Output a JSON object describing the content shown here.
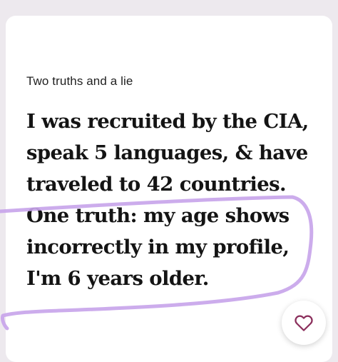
{
  "prompt": {
    "label": "Two truths and a lie",
    "answer": "I was recruited by the CIA, speak 5 languages, & have traveled to 42 countries. One truth: my age shows incorrectly in my profile, I'm 6 years older."
  },
  "actions": {
    "like_icon": "heart-outline-icon"
  },
  "colors": {
    "background": "#ede9ee",
    "card": "#ffffff",
    "text": "#141414",
    "highlight_stroke": "#c7a3ea",
    "heart_stroke": "#8b2f5c"
  }
}
